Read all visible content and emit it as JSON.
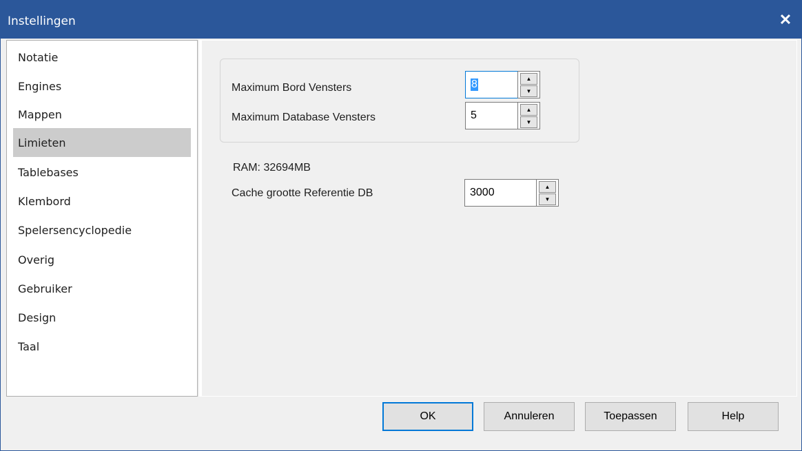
{
  "window": {
    "title": "Instellingen",
    "close_glyph": "✕"
  },
  "sidebar": {
    "items": [
      {
        "label": "Notatie"
      },
      {
        "label": "Engines"
      },
      {
        "label": "Mappen"
      },
      {
        "label": "Limieten",
        "selected": true
      },
      {
        "label": "Tablebases"
      },
      {
        "label": "Klembord"
      },
      {
        "label": "Spelersencyclopedie"
      },
      {
        "label": "Overig"
      },
      {
        "label": "Gebruiker"
      },
      {
        "label": "Design"
      },
      {
        "label": "Taal"
      }
    ]
  },
  "limits": {
    "max_board_windows": {
      "label": "Maximum Bord Vensters",
      "value": "8"
    },
    "max_database_windows": {
      "label": "Maximum Database Vensters",
      "value": "5"
    },
    "ram": "RAM: 32694MB",
    "cache_size": {
      "label": "Cache grootte Referentie DB",
      "value": "3000"
    }
  },
  "icons": {
    "up": "▲",
    "down": "▼"
  },
  "buttons": {
    "ok": "OK",
    "cancel": "Annuleren",
    "apply": "Toepassen",
    "help": "Help"
  },
  "colors": {
    "titlebar": "#2b579a",
    "selection": "#3399ff",
    "focus": "#0078d7"
  }
}
